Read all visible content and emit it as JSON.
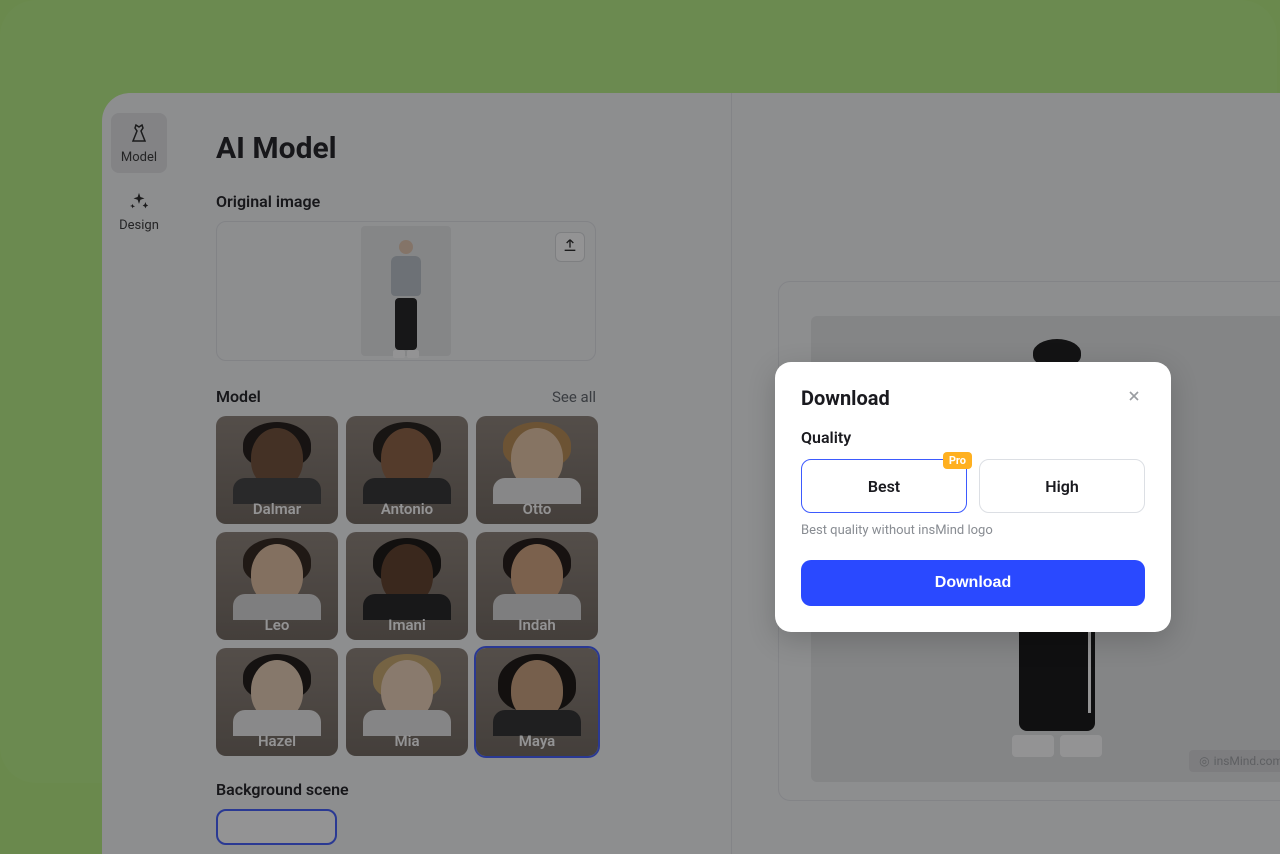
{
  "sidebar": {
    "items": [
      {
        "label": "Model",
        "icon": "dress-icon"
      },
      {
        "label": "Design",
        "icon": "sparkle-icon"
      }
    ]
  },
  "panel": {
    "title": "AI Model",
    "original_label": "Original image",
    "model_label": "Model",
    "see_all": "See all",
    "models": [
      {
        "name": "Dalmar"
      },
      {
        "name": "Antonio"
      },
      {
        "name": "Otto"
      },
      {
        "name": "Leo"
      },
      {
        "name": "Imani"
      },
      {
        "name": "Indah"
      },
      {
        "name": "Hazel"
      },
      {
        "name": "Mia"
      },
      {
        "name": "Maya"
      }
    ],
    "bg_label": "Background scene"
  },
  "watermark": {
    "text": "insMind.com"
  },
  "modal": {
    "title": "Download",
    "quality_label": "Quality",
    "options": {
      "best": "Best",
      "high": "High",
      "pro_badge": "Pro"
    },
    "hint": "Best quality without insMind logo",
    "button": "Download"
  }
}
